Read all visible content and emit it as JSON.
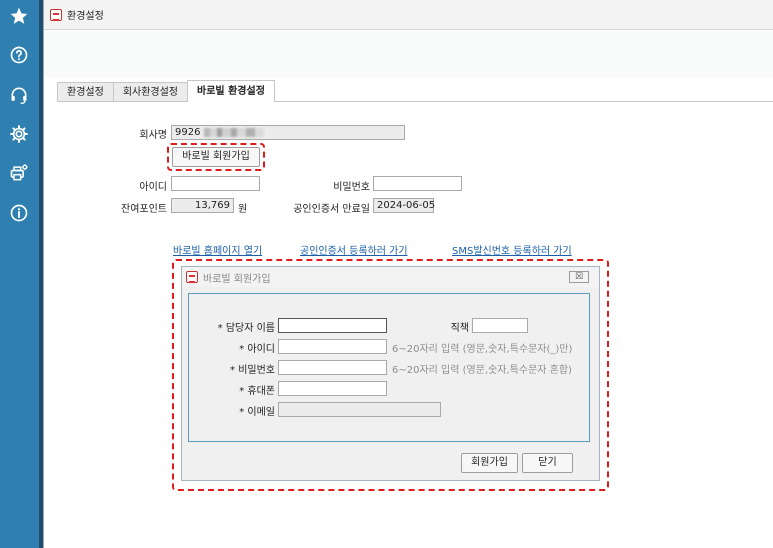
{
  "window": {
    "title": "환경설정"
  },
  "tabs": [
    {
      "label": "환경설정"
    },
    {
      "label": "회사환경설정"
    },
    {
      "label": "바로빌 환경설정"
    }
  ],
  "form": {
    "company_label": "회사명",
    "company_value": "9926",
    "join_button": "바로빌 회원가입",
    "id_label": "아이디",
    "id_value": "",
    "password_label": "비밀번호",
    "password_value": "",
    "points_label": "잔여포인트",
    "points_value": "13,769",
    "points_unit": "원",
    "cert_label": "공인인증서 만료일",
    "cert_value": "2024-06-05"
  },
  "links": {
    "homepage": "바로빌 홈페이지 열기",
    "cert_register": "공인인증서 등록하러 가기",
    "sms_register": "SMS발신번호 등록하러 가기"
  },
  "dialog": {
    "title": "바로빌 회원가입",
    "close_glyph": "☒",
    "name_label": "* 담당자 이름",
    "position_label": "직책",
    "id_label": "* 아이디",
    "id_hint": "6~20자리 입력 (영문,숫자,특수문자(_)만)",
    "password_label": "* 비밀번호",
    "password_hint": "6~20자리 입력 (영문,숫자,특수문자 혼합)",
    "phone_label": "* 휴대폰",
    "email_label": "* 이메일",
    "join_button": "회원가입",
    "close_button": "닫기"
  },
  "sidebar": {
    "icons": [
      "star-icon",
      "help-icon",
      "headset-icon",
      "gear-icon",
      "printer-settings-icon",
      "info-icon"
    ]
  },
  "colors": {
    "sidebar": "#2f80b0",
    "highlight": "#e01b1b",
    "link": "#1a5fa8",
    "dialog_border": "#5b9bbf"
  }
}
